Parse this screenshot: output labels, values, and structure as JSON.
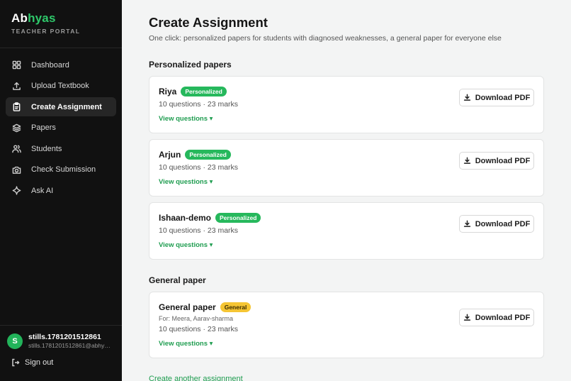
{
  "brand": {
    "name_part1": "Ab",
    "name_part2": "hyas",
    "subtitle": "TEACHER PORTAL"
  },
  "nav": [
    {
      "label": "Dashboard",
      "icon": "grid-icon",
      "active": false
    },
    {
      "label": "Upload Textbook",
      "icon": "upload-icon",
      "active": false
    },
    {
      "label": "Create Assignment",
      "icon": "clipboard-icon",
      "active": true
    },
    {
      "label": "Papers",
      "icon": "layers-icon",
      "active": false
    },
    {
      "label": "Students",
      "icon": "users-icon",
      "active": false
    },
    {
      "label": "Check Submission",
      "icon": "camera-icon",
      "active": false
    },
    {
      "label": "Ask AI",
      "icon": "sparkle-icon",
      "active": false
    }
  ],
  "user": {
    "initial": "S",
    "name": "stills.1781201512861",
    "email": "stills.1781201512861@abhyas.com"
  },
  "signout_label": "Sign out",
  "page": {
    "title": "Create Assignment",
    "subtitle": "One click: personalized papers for students with diagnosed weaknesses, a general paper for everyone else"
  },
  "personalized_section_title": "Personalized papers",
  "personalized": [
    {
      "name": "Riya",
      "badge": "Personalized",
      "meta": "10 questions · 23 marks",
      "view": "View questions ▾",
      "button": "Download PDF"
    },
    {
      "name": "Arjun",
      "badge": "Personalized",
      "meta": "10 questions · 23 marks",
      "view": "View questions ▾",
      "button": "Download PDF"
    },
    {
      "name": "Ishaan-demo",
      "badge": "Personalized",
      "meta": "10 questions · 23 marks",
      "view": "View questions ▾",
      "button": "Download PDF"
    }
  ],
  "general_section_title": "General paper",
  "general": {
    "name": "General paper",
    "badge": "General",
    "for": "For: Meera, Aarav-sharma",
    "meta": "10 questions · 23 marks",
    "view": "View questions ▾",
    "button": "Download PDF"
  },
  "footer_link": "Create another assignment",
  "colors": {
    "accent": "#1f9d50",
    "badge_green": "#26b85c",
    "badge_yellow": "#f5c533",
    "sidebar_bg": "#111111"
  }
}
